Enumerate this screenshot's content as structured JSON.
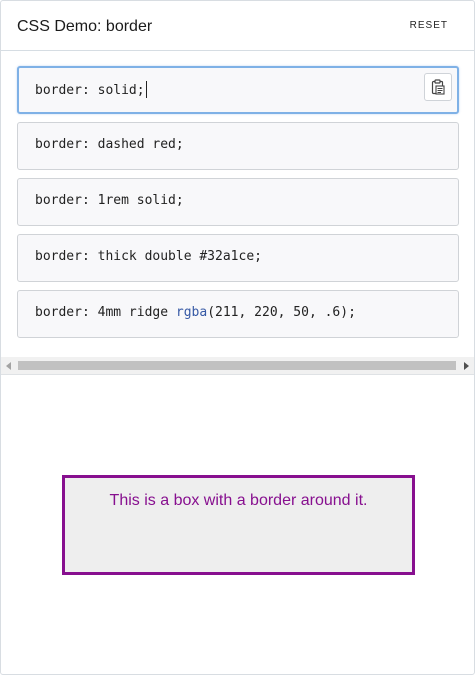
{
  "header": {
    "title": "CSS Demo: border",
    "reset_label": "RESET"
  },
  "choices": [
    {
      "text": "border: solid;",
      "selected": true
    },
    {
      "text": "border: dashed red;"
    },
    {
      "text": "border: 1rem solid;"
    },
    {
      "text": "border: thick double #32a1ce;"
    },
    {
      "prefix": "border: 4mm ridge ",
      "fn": "rgba",
      "suffix": "(211, 220, 50, .6);"
    }
  ],
  "copy_button": {
    "icon": "clipboard-icon"
  },
  "scrollbar": {
    "left_icon": "scroll-left-icon",
    "right_icon": "scroll-right-icon"
  },
  "output": {
    "box_text": "This is a box with a border around it.",
    "border_color": "#870f8f",
    "background": "#eeeeee"
  },
  "colors": {
    "selected_border": "#7fb1e6",
    "function_color": "#3659a5"
  }
}
